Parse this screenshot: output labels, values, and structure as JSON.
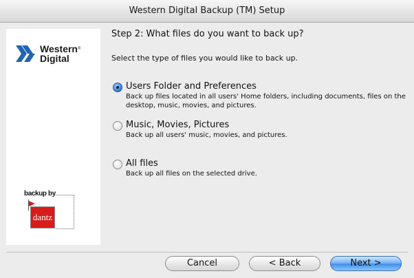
{
  "window": {
    "title": "Western Digital Backup (TM) Setup"
  },
  "branding": {
    "wd_line1": "Western",
    "wd_line2": "Digital",
    "wd_mark": "®",
    "dantz_label": "backup by",
    "dantz_name": "dantz"
  },
  "content": {
    "step_title": "Step 2: What files do you want to back up?",
    "instruction": "Select the type of files you would like to back up.",
    "options": [
      {
        "label": "Users Folder and Preferences",
        "description": "Back up files located in all users' Home folders, including documents, files on the desktop, music, movies, and pictures.",
        "selected": true
      },
      {
        "label": "Music, Movies, Pictures",
        "description": "Back up all users' music, movies, and pictures.",
        "selected": false
      },
      {
        "label": "All files",
        "description": "Back up all files on the selected drive.",
        "selected": false
      }
    ]
  },
  "buttons": {
    "cancel": "Cancel",
    "back": "< Back",
    "next": "Next >"
  },
  "colors": {
    "accent": "#3f8ee6",
    "dantz_red": "#d71c1c"
  }
}
